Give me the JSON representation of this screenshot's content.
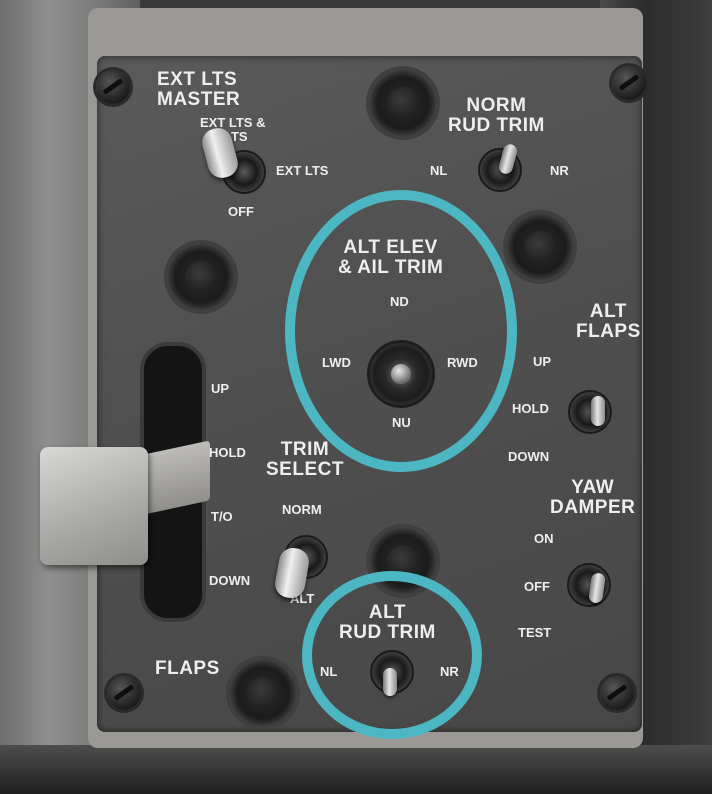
{
  "panel": {
    "ext_lts": {
      "title_line1": "EXT LTS",
      "title_line2": "MASTER",
      "pos_up_line1": "EXT LTS &",
      "pos_up_line2": "LTS",
      "pos_mid": "EXT LTS",
      "pos_off": "OFF"
    },
    "norm_rud_trim": {
      "title_line1": "NORM",
      "title_line2": "RUD TRIM",
      "left": "NL",
      "right": "NR"
    },
    "alt_elev_ail_trim": {
      "title_line1": "ALT ELEV",
      "title_line2": "& AIL TRIM",
      "up": "ND",
      "left": "LWD",
      "right": "RWD",
      "down": "NU"
    },
    "alt_flaps": {
      "title_line1": "ALT",
      "title_line2": "FLAPS",
      "up": "UP",
      "mid": "HOLD",
      "down": "DOWN"
    },
    "flaps": {
      "title": "FLAPS",
      "up": "UP",
      "hold": "HOLD",
      "to": "T/O",
      "down": "DOWN"
    },
    "trim_select": {
      "title_line1": "TRIM",
      "title_line2": "SELECT",
      "up": "NORM",
      "down": "ALT"
    },
    "yaw_damper": {
      "title_line1": "YAW",
      "title_line2": "DAMPER",
      "up": "ON",
      "mid": "OFF",
      "down": "TEST"
    },
    "alt_rud_trim": {
      "title_line1": "ALT",
      "title_line2": "RUD TRIM",
      "left": "NL",
      "right": "NR"
    }
  },
  "highlight_color": "#4cb6c3",
  "highlighted_controls": [
    "alt-elev-ail-trim",
    "alt-rud-trim"
  ]
}
